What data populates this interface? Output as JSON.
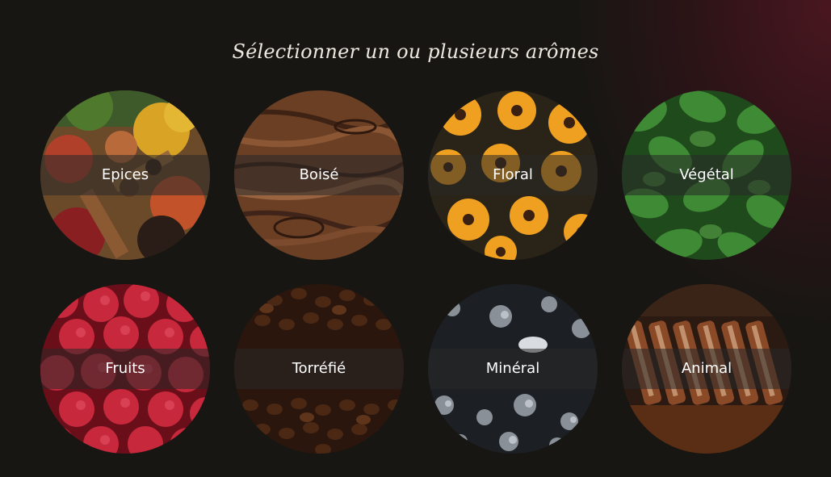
{
  "heading": "Sélectionner un ou plusieurs arômes",
  "aromas": [
    {
      "label": "Epices",
      "image": "spices-photo"
    },
    {
      "label": "Boisé",
      "image": "wood-grain-photo"
    },
    {
      "label": "Floral",
      "image": "orange-flowers-photo"
    },
    {
      "label": "Végétal",
      "image": "basil-leaves-photo"
    },
    {
      "label": "Fruits",
      "image": "raspberries-photo"
    },
    {
      "label": "Torréfié",
      "image": "coffee-beans-photo"
    },
    {
      "label": "Minéral",
      "image": "rock-minerals-photo"
    },
    {
      "label": "Animal",
      "image": "grilled-meat-photo"
    }
  ]
}
